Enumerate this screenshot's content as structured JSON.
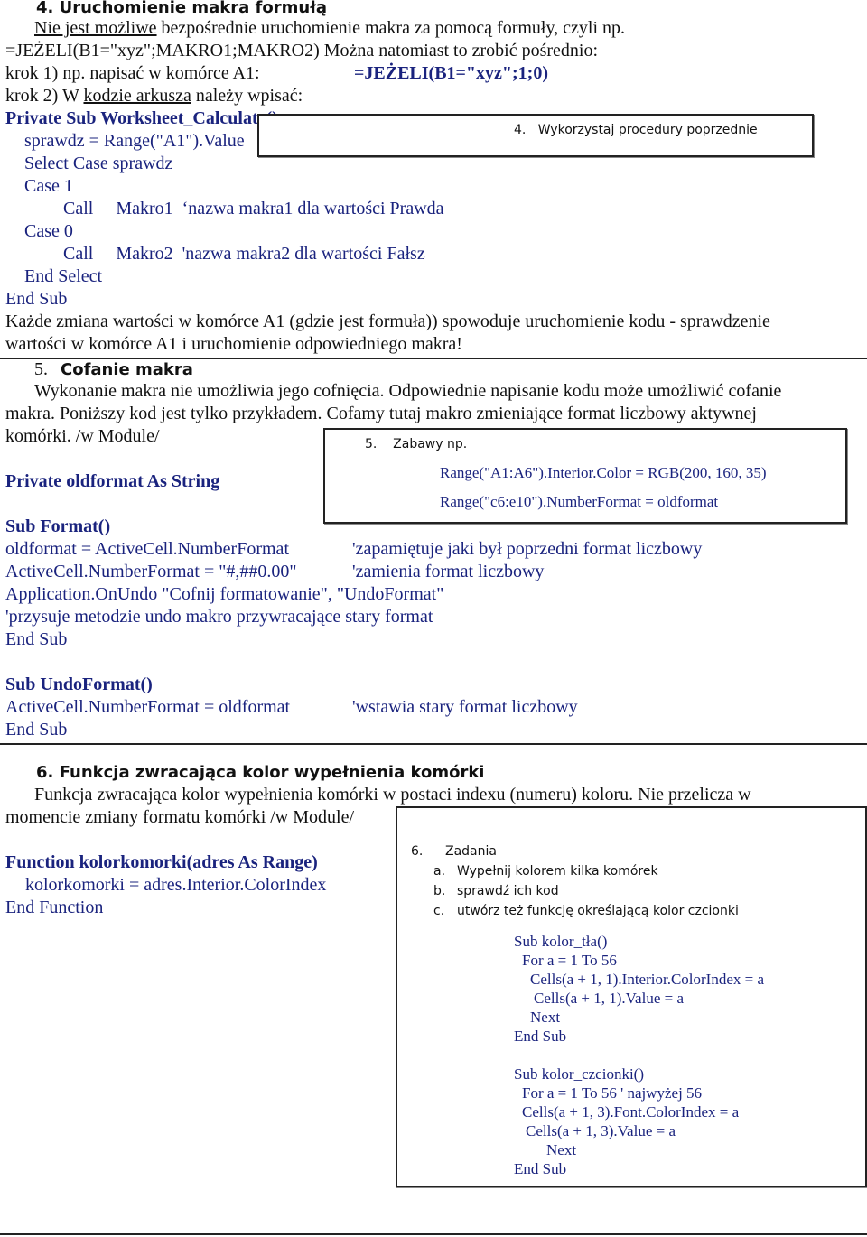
{
  "section4": {
    "heading": "4.  Uruchomienie makra formułą",
    "line1_underlined": "Nie jest możliwe",
    "line1_rest": " bezpośrednie uruchomienie makra za pomocą formuły, czyli np.",
    "line2": "=JEŻELI(B1=\"xyz\";MAKRO1;MAKRO2)   Można natomiast to zrobić pośrednio:",
    "line3_text": "krok 1) np. napisać w komórce  A1:",
    "line3_formula": "=JEŻELI(B1=\"xyz\";1;0)",
    "line4_prefix": "krok 2) W ",
    "line4_underlined": "kodzie arkusza",
    "line4_rest": " należy wpisać:",
    "code": [
      "Private Sub Worksheet_Calculate()",
      "sprawdz = Range(\"A1\").Value",
      "Select Case sprawdz",
      "Case 1",
      "Call     Makro1  ‘nazwa makra1 dla wartości Prawda",
      "Case 0",
      "Call     Makro2  'nazwa makra2 dla wartości Fałsz",
      "End Select",
      "End Sub"
    ],
    "note_line1": "Każde zmiana wartości w komórce A1 (gdzie jest formuła)) spowoduje uruchomienie kodu - sprawdzenie",
    "note_line2": "wartości w komórce A1 i uruchomienie odpowiedniego makra!",
    "callout": "4.   Wykorzystaj procedury poprzednie"
  },
  "section5": {
    "heading_num": "5.",
    "heading_text": "Cofanie makra",
    "para_line1": "Wykonanie makra nie umożliwia jego cofnięcia. Odpowiednie napisanie kodu może umożliwić cofanie",
    "para_line2": "makra. Poniższy kod jest tylko przykładem. Cofamy tutaj makro zmieniające format liczbowy aktywnej",
    "para_line3": "komórki.  /w Module/",
    "code_decl": "Private oldformat As String",
    "code_sub1": "Sub Format()",
    "code_lines": [
      {
        "code": "oldformat = ActiveCell.NumberFormat",
        "comment": "'zapamiętuje jaki był poprzedni format liczbowy"
      },
      {
        "code": "ActiveCell.NumberFormat = \"#,##0.00\"",
        "comment": "'zamienia format liczbowy"
      }
    ],
    "code_onundo": "Application.OnUndo \"Cofnij formatowanie\", \"UndoFormat\"",
    "code_comment": "'przysuje metodzie undo makro przywracające stary format",
    "code_endsub1": "End Sub",
    "code_sub2": "Sub UndoFormat()",
    "code_sub2_line": {
      "code": "ActiveCell.NumberFormat = oldformat",
      "comment": "'wstawia stary format liczbowy"
    },
    "code_endsub2": "End Sub",
    "callout": {
      "title": "5.    Zabawy np.",
      "line1": "Range(\"A1:A6\").Interior.Color = RGB(200, 160, 35)",
      "line2": "Range(\"c6:e10\").NumberFormat = oldformat"
    }
  },
  "section6": {
    "heading": "6.  Funkcja zwracająca kolor wypełnienia komórki",
    "para_line1": "Funkcja zwracająca kolor wypełnienia komórki w postaci indexu (numeru) koloru. Nie przelicza w",
    "para_line2": "momencie zmiany formatu komórki /w Module/",
    "code": [
      "Function kolorkomorki(adres As Range)",
      "kolorkomorki = adres.Interior.ColorIndex",
      "End Function"
    ],
    "callout": {
      "title_num": "6.",
      "title": "Zadania",
      "items": [
        {
          "marker": "a.",
          "text": "Wypełnij kolorem kilka komórek"
        },
        {
          "marker": "b.",
          "text": "sprawdź ich kod"
        },
        {
          "marker": "c.",
          "text": "utwórz też funkcję określającą kolor czcionki"
        }
      ],
      "code1": [
        "Sub kolor_tła()",
        "For a = 1 To 56",
        "Cells(a + 1, 1).Interior.ColorIndex = a",
        "Cells(a + 1, 1).Value = a",
        "Next",
        "End Sub"
      ],
      "code2": [
        "Sub kolor_czcionki()",
        "For a = 1 To 56 ' najwyżej 56",
        "Cells(a + 1, 3).Font.ColorIndex = a",
        "Cells(a + 1, 3).Value = a",
        "Next",
        "End Sub"
      ]
    }
  }
}
